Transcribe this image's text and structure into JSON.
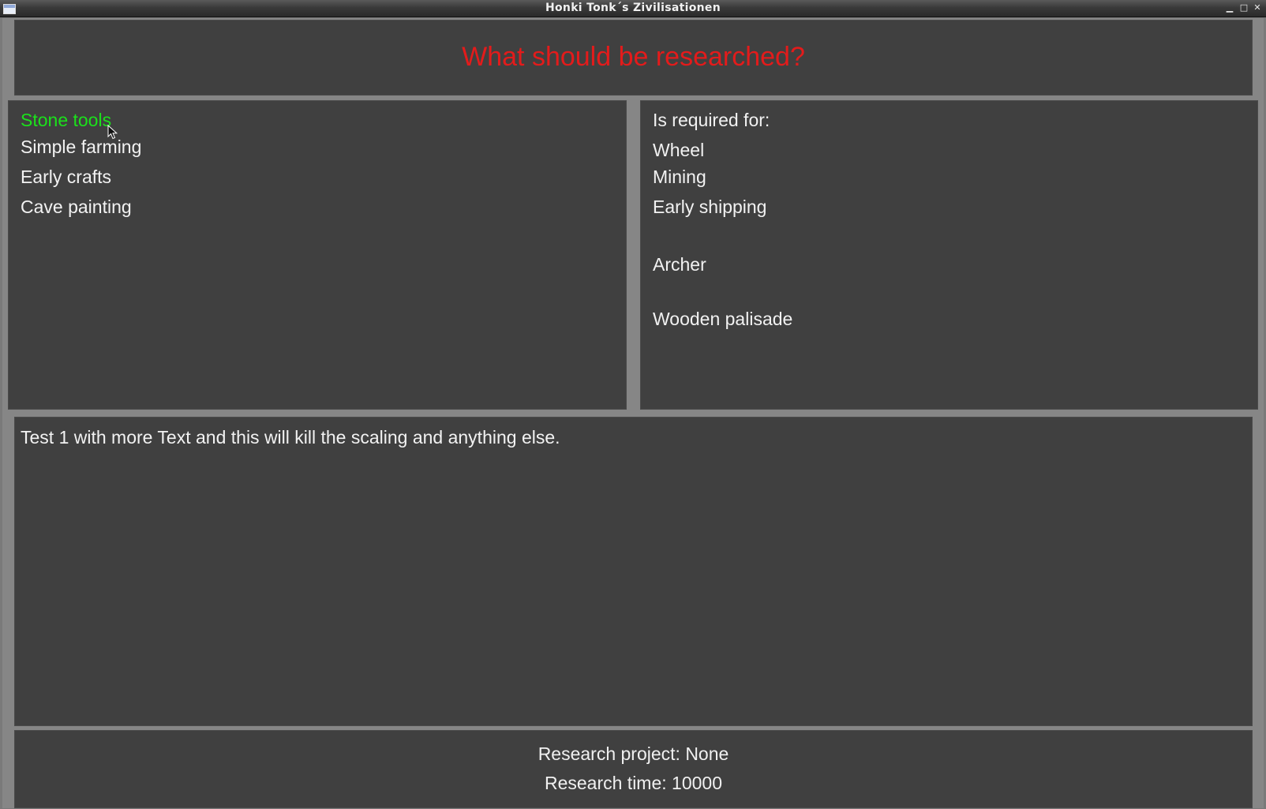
{
  "window": {
    "title": "Honki Tonk´s Zivilisationen",
    "controls": [
      "minimize-icon",
      "maximize-icon",
      "close-icon"
    ]
  },
  "header": {
    "heading": "What should be researched?"
  },
  "research_list": {
    "items": [
      {
        "label": "Stone tools",
        "selected": true
      },
      {
        "label": "Simple farming",
        "selected": false
      },
      {
        "label": "Early crafts",
        "selected": false
      },
      {
        "label": "Cave painting",
        "selected": false
      }
    ]
  },
  "requirements": {
    "heading": "Is required for:",
    "items": [
      "Wheel",
      "Mining",
      "Early shipping",
      "Archer",
      "Wooden palisade"
    ]
  },
  "description": {
    "text": "Test 1 with more Text and this will kill the scaling and anything else."
  },
  "footer": {
    "project": "Research project: None",
    "time": "Research time: 10000"
  },
  "colors": {
    "heading": "#e31b1b",
    "selected": "#1be11b",
    "text": "#f2f2f2",
    "panel": "#404040",
    "frame": "#868686"
  }
}
